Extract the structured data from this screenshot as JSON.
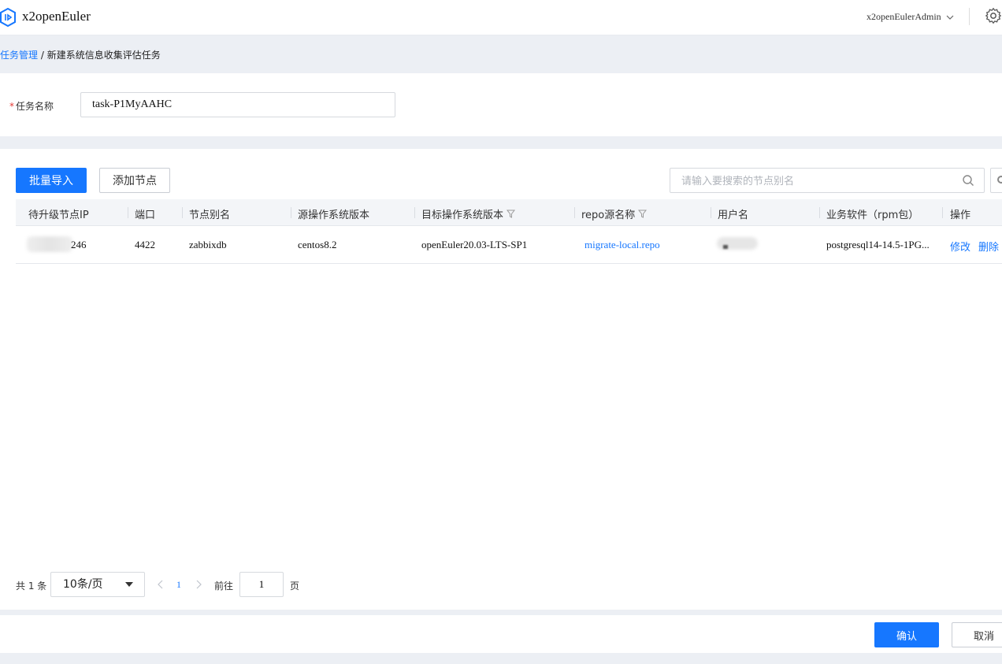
{
  "header": {
    "app_title": "x2openEuler",
    "user_name": "x2openEulerAdmin",
    "logo_icon": "hexagon-logo-icon",
    "settings_icon": "gear-icon"
  },
  "breadcrumb": {
    "parent": "任务管理",
    "separator": " / ",
    "current": "新建系统信息收集评估任务"
  },
  "form": {
    "task_name_required_mark": "*",
    "task_name_label": "任务名称",
    "task_name_value": "task-P1MyAAHC"
  },
  "toolbar": {
    "batch_import_label": "批量导入",
    "add_node_label": "添加节点",
    "search_placeholder": "请输入要搜索的节点别名"
  },
  "table": {
    "columns": [
      "待升级节点IP",
      "端口",
      "节点别名",
      "源操作系统版本",
      "目标操作系统版本",
      "repo源名称",
      "用户名",
      "业务软件（rpm包）",
      "操作"
    ],
    "rows": [
      {
        "ip_suffix": "246",
        "port": "4422",
        "alias": "zabbixdb",
        "source_os": "centos8.2",
        "target_os": "openEuler20.03-LTS-SP1",
        "repo": "migrate-local.repo",
        "software": "postgresql14-14.5-1PG...",
        "edit": "修改",
        "delete": "删除"
      }
    ]
  },
  "pagination": {
    "total": "共 1 条",
    "page_size": "10条/页",
    "current_page": "1",
    "goto_label": "前往",
    "goto_value": "1",
    "page_suffix": "页"
  },
  "footer": {
    "confirm_label": "确认",
    "cancel_label": "取消"
  },
  "colors": {
    "primary": "#1677ff",
    "band": "#eceff4",
    "required": "#e53935"
  }
}
